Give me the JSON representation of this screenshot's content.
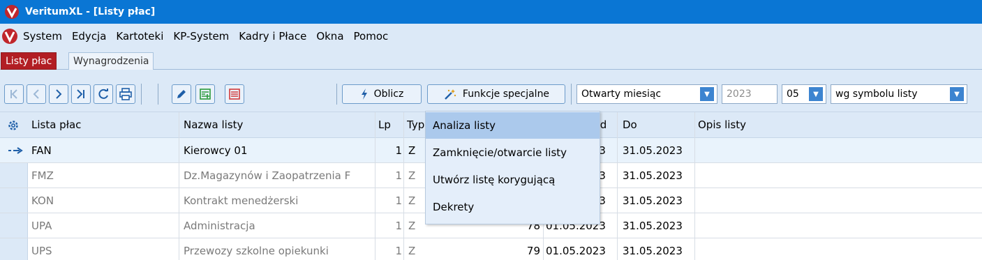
{
  "window": {
    "title": "VeritumXL - [Listy płac]"
  },
  "menu": [
    "System",
    "Edycja",
    "Kartoteki",
    "KP-System",
    "Kadry i Płace",
    "Okna",
    "Pomoc"
  ],
  "tabs": [
    {
      "label": "Listy płac",
      "active": true
    },
    {
      "label": "Wynagrodzenia",
      "active": false
    }
  ],
  "toolbar": {
    "calc_label": "Oblicz",
    "special_label": "Funkcje specjalne",
    "month_state": "Otwarty miesiąc",
    "year": "2023",
    "month": "05",
    "sort": "wg symbolu listy"
  },
  "columns": {
    "lista": "Lista płac",
    "nazwa": "Nazwa listy",
    "lp": "Lp",
    "typ": "Typ",
    "od": "Od",
    "do": "Do",
    "opis": "Opis listy"
  },
  "rows": [
    {
      "lista": "FAN",
      "nazwa": "Kierowcy 01",
      "lp": "1",
      "typ": "Z",
      "nr": "",
      "od": "01.05.2023",
      "do": "31.05.2023",
      "current": true
    },
    {
      "lista": "FMZ",
      "nazwa": "Dz.Magazynów i Zaopatrzenia F",
      "lp": "1",
      "typ": "Z",
      "nr": "",
      "od": "01.05.2023",
      "do": "31.05.2023",
      "current": false
    },
    {
      "lista": "KON",
      "nazwa": "Kontrakt menedżerski",
      "lp": "1",
      "typ": "Z",
      "nr": "",
      "od": "01.05.2023",
      "do": "31.05.2023",
      "current": false
    },
    {
      "lista": "UPA",
      "nazwa": "Administracja",
      "lp": "1",
      "typ": "Z",
      "nr": "78",
      "od": "01.05.2023",
      "do": "31.05.2023",
      "current": false
    },
    {
      "lista": "UPS",
      "nazwa": "Przewozy szkolne opiekunki",
      "lp": "1",
      "typ": "Z",
      "nr": "79",
      "od": "01.05.2023",
      "do": "31.05.2023",
      "current": false
    }
  ],
  "dropdown": {
    "items": [
      "Analiza listy",
      "Zamknięcie/otwarcie listy",
      "Utwórz listę korygującą",
      "Dekrety"
    ],
    "highlighted": "Analiza listy"
  },
  "colors": {
    "title_bar": "#0a76d4",
    "active_tab": "#b21e24",
    "menu_highlight": "#abc9ec",
    "background": "#dce9f7"
  },
  "icons": [
    "first-record-icon",
    "previous-record-icon",
    "next-record-icon",
    "last-record-icon",
    "refresh-icon",
    "print-icon",
    "edit-icon",
    "add-list-icon",
    "remove-list-icon",
    "lightning-icon",
    "magic-wand-icon",
    "settings-gear-icon",
    "current-row-arrow-icon"
  ]
}
